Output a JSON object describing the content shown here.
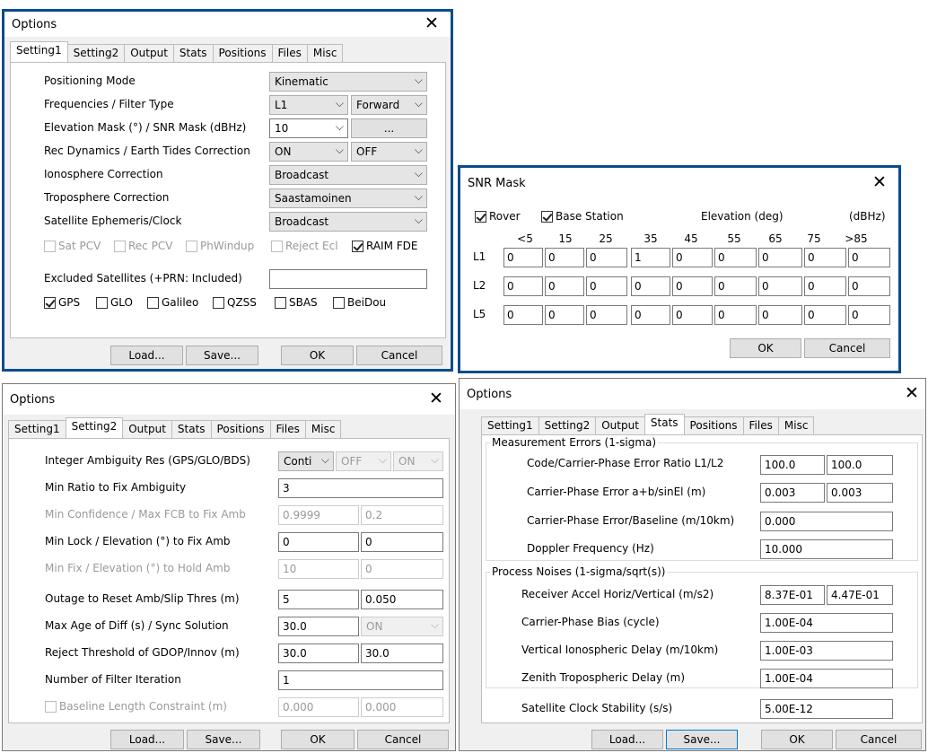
{
  "win1": {
    "title": "Options",
    "tabs": [
      "Setting1",
      "Setting2",
      "Output",
      "Stats",
      "Positions",
      "Files",
      "Misc"
    ],
    "rows": [
      {
        "label": "Positioning Mode",
        "c1": "Kinematic"
      },
      {
        "label": "Frequencies / Filter Type",
        "c1": "L1",
        "c2": "Forward"
      },
      {
        "label": "Elevation Mask (°) / SNR Mask (dBHz)",
        "c1": "10",
        "button": "..."
      },
      {
        "label": "Rec Dynamics / Earth Tides Correction",
        "c1": "ON",
        "c2": "OFF"
      },
      {
        "label": "Ionosphere Correction",
        "c1": "Broadcast"
      },
      {
        "label": "Troposphere Correction",
        "c1": "Saastamoinen"
      },
      {
        "label": "Satellite Ephemeris/Clock",
        "c1": "Broadcast"
      }
    ],
    "checks1": [
      {
        "label": "Sat PCV",
        "checked": false,
        "disabled": true
      },
      {
        "label": "Rec PCV",
        "checked": false,
        "disabled": true
      },
      {
        "label": "PhWindup",
        "checked": false,
        "disabled": true
      },
      {
        "label": "Reject Ecl",
        "checked": false,
        "disabled": true
      },
      {
        "label": "RAIM FDE",
        "checked": true,
        "disabled": false
      }
    ],
    "excluded_label": "Excluded Satellites (+PRN: Included)",
    "excluded_value": "",
    "checks2": [
      {
        "label": "GPS",
        "checked": true
      },
      {
        "label": "GLO",
        "checked": false
      },
      {
        "label": "Galileo",
        "checked": false
      },
      {
        "label": "QZSS",
        "checked": false
      },
      {
        "label": "SBAS",
        "checked": false
      },
      {
        "label": "BeiDou",
        "checked": false
      }
    ],
    "buttons": {
      "load": "Load...",
      "save": "Save...",
      "ok": "OK",
      "cancel": "Cancel"
    }
  },
  "snr": {
    "title": "SNR Mask",
    "rover": "Rover",
    "base": "Base Station",
    "elev": "Elevation (deg)",
    "unit": "(dBHz)",
    "headers": [
      "<5",
      "15",
      "25",
      "35",
      "45",
      "55",
      "65",
      "75",
      ">85"
    ],
    "rows": [
      {
        "name": "L1",
        "values": [
          "0",
          "0",
          "0",
          "1",
          "0",
          "0",
          "0",
          "0",
          "0"
        ]
      },
      {
        "name": "L2",
        "values": [
          "0",
          "0",
          "0",
          "0",
          "0",
          "0",
          "0",
          "0",
          "0"
        ]
      },
      {
        "name": "L5",
        "values": [
          "0",
          "0",
          "0",
          "0",
          "0",
          "0",
          "0",
          "0",
          "0"
        ]
      }
    ],
    "ok": "OK",
    "cancel": "Cancel"
  },
  "win2": {
    "title": "Options",
    "tabs": [
      "Setting1",
      "Setting2",
      "Output",
      "Stats",
      "Positions",
      "Files",
      "Misc"
    ],
    "rows": [
      {
        "label": "Integer Ambiguity Res (GPS/GLO/BDS)"
      },
      {
        "label": "Min Ratio to Fix Ambiguity",
        "v1": "3"
      },
      {
        "label": "Min Confidence / Max FCB to Fix Amb",
        "v1": "0.9999",
        "v2": "0.2"
      },
      {
        "label": "Min Lock / Elevation (°) to Fix Amb",
        "v1": "0",
        "v2": "0"
      },
      {
        "label": "Min Fix / Elevation (°) to Hold Amb",
        "v1": "10",
        "v2": "0"
      },
      {
        "label": "Outage to Reset Amb/Slip Thres (m)",
        "v1": "5",
        "v2": "0.050"
      },
      {
        "label": "Max Age of Diff (s) / Sync Solution",
        "v1": "30.0",
        "v2": "ON"
      },
      {
        "label": "Reject Threshold of GDOP/Innov (m)",
        "v1": "30.0",
        "v2": "30.0"
      },
      {
        "label": "Number of Filter Iteration",
        "v1": "1"
      },
      {
        "label": "Baseline Length Constraint (m)",
        "v1": "0.000",
        "v2": "0.000"
      }
    ],
    "ar_combos": [
      "Conti",
      "OFF",
      "ON"
    ],
    "buttons": {
      "load": "Load...",
      "save": "Save...",
      "ok": "OK",
      "cancel": "Cancel"
    }
  },
  "win3": {
    "title": "Options",
    "tabs": [
      "Setting1",
      "Setting2",
      "Output",
      "Stats",
      "Positions",
      "Files",
      "Misc"
    ],
    "group1": "Measurement Errors (1-sigma)",
    "group2": "Process Noises (1-sigma/sqrt(s))",
    "rows1": [
      {
        "label": "Code/Carrier-Phase Error Ratio L1/L2",
        "v1": "100.0",
        "v2": "100.0"
      },
      {
        "label": "Carrier-Phase Error a+b/sinEl (m)",
        "v1": "0.003",
        "v2": "0.003"
      },
      {
        "label": "Carrier-Phase Error/Baseline (m/10km)",
        "v1": "0.000"
      },
      {
        "label": "Doppler Frequency (Hz)",
        "v1": "10.000"
      }
    ],
    "rows2": [
      {
        "label": "Receiver Accel Horiz/Vertical (m/s2)",
        "v1": "8.37E-01",
        "v2": "4.47E-01"
      },
      {
        "label": "Carrier-Phase Bias (cycle)",
        "v1": "1.00E-04"
      },
      {
        "label": "Vertical Ionospheric Delay (m/10km)",
        "v1": "1.00E-03"
      },
      {
        "label": "Zenith Tropospheric Delay (m)",
        "v1": "1.00E-04"
      }
    ],
    "clock_label": "Satellite Clock Stability (s/s)",
    "clock_value": "5.00E-12",
    "buttons": {
      "load": "Load...",
      "save": "Save...",
      "ok": "OK",
      "cancel": "Cancel"
    }
  }
}
